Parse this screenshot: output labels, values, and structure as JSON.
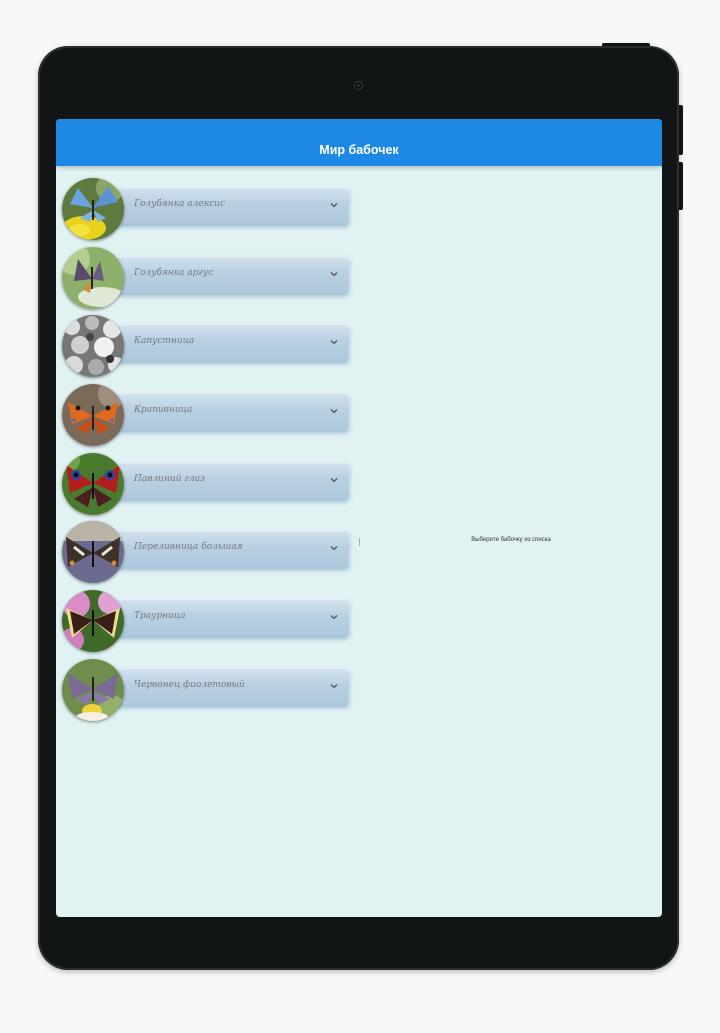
{
  "app": {
    "title": "Мир бабочек"
  },
  "butterflies": [
    {
      "label": "Голубянка алексис",
      "icon": "expand-chevron-icon"
    },
    {
      "label": "Голубянка аргус",
      "icon": "expand-chevron-icon"
    },
    {
      "label": "Капустница",
      "icon": "expand-chevron-icon"
    },
    {
      "label": "Крапивница",
      "icon": "expand-chevron-icon"
    },
    {
      "label": "Павлиний глаз",
      "icon": "expand-chevron-icon"
    },
    {
      "label": "Переливница большая",
      "icon": "expand-chevron-icon"
    },
    {
      "label": "Траурница",
      "icon": "expand-chevron-icon"
    },
    {
      "label": "Червонец фиолетовый",
      "icon": "expand-chevron-icon"
    }
  ],
  "detail": {
    "placeholder": "Выберите бабочку из списка"
  },
  "colors": {
    "appbar": "#1e88e5",
    "background": "#e1f2f3",
    "card": "#b9d0e2",
    "device": "#121516"
  }
}
